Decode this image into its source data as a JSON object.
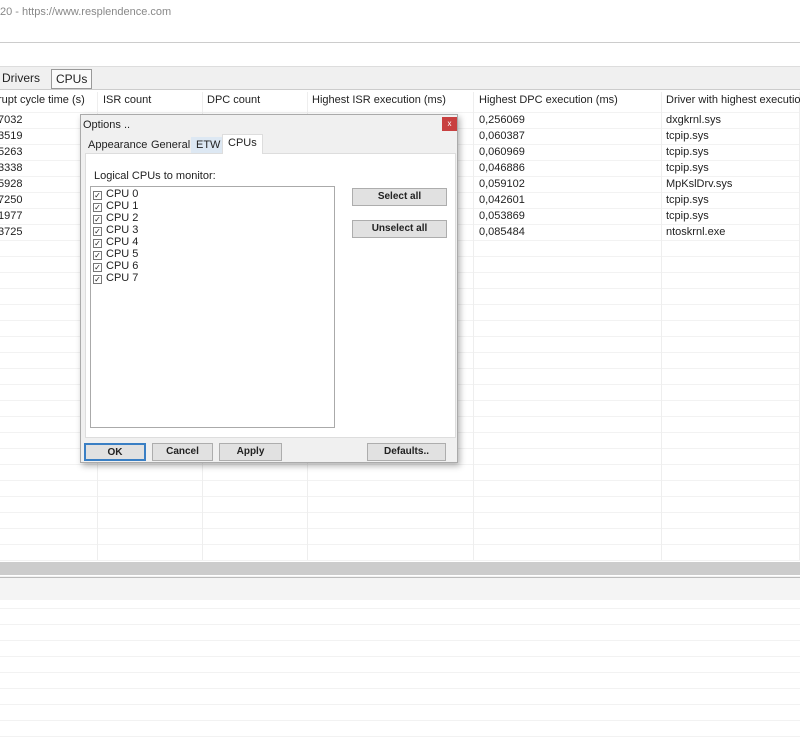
{
  "window": {
    "title": "20 - https://www.resplendence.com"
  },
  "main_tabs": [
    {
      "label": "Drivers"
    },
    {
      "label": "CPUs"
    }
  ],
  "table": {
    "headers": [
      "rupt cycle time (s)",
      "ISR count",
      "DPC count",
      "Highest ISR execution (ms)",
      "Highest DPC execution (ms)",
      "Driver with highest execution"
    ],
    "rows": [
      [
        "7032",
        "",
        "",
        "",
        "0,256069",
        "dxgkrnl.sys"
      ],
      [
        "3519",
        "",
        "",
        "",
        "0,060387",
        "tcpip.sys"
      ],
      [
        "5263",
        "",
        "",
        "",
        "0,060969",
        "tcpip.sys"
      ],
      [
        "3338",
        "",
        "",
        "",
        "0,046886",
        "tcpip.sys"
      ],
      [
        "5928",
        "",
        "",
        "",
        "0,059102",
        "MpKslDrv.sys"
      ],
      [
        "7250",
        "",
        "",
        "",
        "0,042601",
        "tcpip.sys"
      ],
      [
        "1977",
        "",
        "",
        "",
        "0,053869",
        "tcpip.sys"
      ],
      [
        "3725",
        "",
        "",
        "",
        "0,085484",
        "ntoskrnl.exe"
      ]
    ]
  },
  "dialog": {
    "title": "Options ..",
    "close": "x",
    "tabs": [
      {
        "label": "Appearance"
      },
      {
        "label": "General"
      },
      {
        "label": "ETW"
      },
      {
        "label": "CPUs"
      }
    ],
    "list_label": "Logical CPUs to monitor:",
    "cpus": [
      {
        "label": "CPU 0",
        "checked": true
      },
      {
        "label": "CPU 1",
        "checked": true
      },
      {
        "label": "CPU 2",
        "checked": true
      },
      {
        "label": "CPU 3",
        "checked": true
      },
      {
        "label": "CPU 4",
        "checked": true
      },
      {
        "label": "CPU 5",
        "checked": true
      },
      {
        "label": "CPU 6",
        "checked": true
      },
      {
        "label": "CPU 7",
        "checked": true
      }
    ],
    "select_all": "Select all",
    "unselect_all": "Unselect all",
    "ok": "OK",
    "cancel": "Cancel",
    "apply": "Apply",
    "defaults": "Defaults.."
  }
}
